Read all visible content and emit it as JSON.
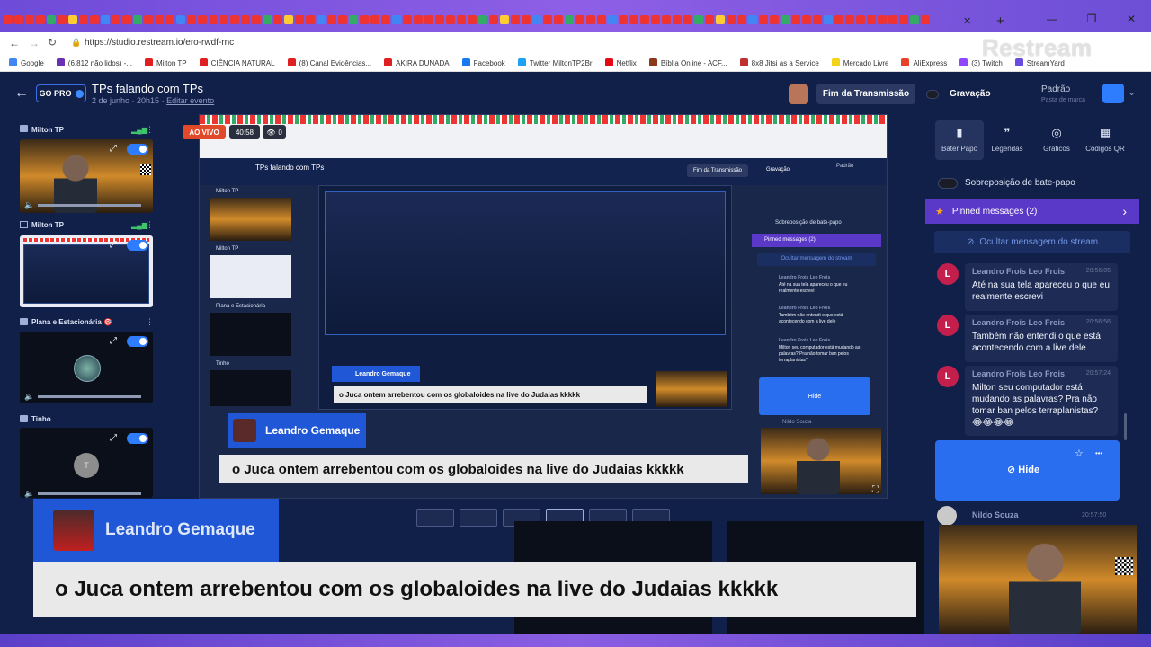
{
  "browser": {
    "url": "https://studio.restream.io/ero-rwdf-rnc",
    "window_controls": [
      "—",
      "❐",
      "✕"
    ],
    "new_tab": "+",
    "close_tab": "✕",
    "bookmarks": [
      {
        "label": "Google",
        "color": "#4285f4"
      },
      {
        "label": "(6.812 não lidos) -...",
        "color": "#6b2fb3"
      },
      {
        "label": "Milton TP",
        "color": "#e02020"
      },
      {
        "label": "CIÊNCIA NATURAL",
        "color": "#e02020"
      },
      {
        "label": "(8) Canal Evidências...",
        "color": "#e02020"
      },
      {
        "label": "AKIRA DUNADA",
        "color": "#e02020"
      },
      {
        "label": "Facebook",
        "color": "#1877f2"
      },
      {
        "label": "Twitter MiltonTP2Br",
        "color": "#1da1f2"
      },
      {
        "label": "Netflix",
        "color": "#e50914"
      },
      {
        "label": "Bíblia Online - ACF...",
        "color": "#8b3a1a"
      },
      {
        "label": "8x8 Jitsi as a Service",
        "color": "#c03030"
      },
      {
        "label": "Mercado Livre",
        "color": "#f5d21a"
      },
      {
        "label": "AliExpress",
        "color": "#e8432a"
      },
      {
        "label": "(3) Twitch",
        "color": "#9146ff"
      },
      {
        "label": "StreamYard",
        "color": "#6a4be0"
      }
    ],
    "watermark": "Restream"
  },
  "header": {
    "back_icon": "←",
    "go_pro": "GO PRO",
    "event_title": "TPs falando com TPs",
    "event_date": "2 de junho · 20h15 ·",
    "edit_event": "Editar evento",
    "end_stream": "Fim da Transmissão",
    "recording": "Gravação",
    "brand_title": "Padrão",
    "brand_sub": "Pasta de marca",
    "brand_chevron": "⌄"
  },
  "sources": [
    {
      "name": "Milton TP"
    },
    {
      "name": "Milton TP"
    },
    {
      "name": "Plana e Estacionária 🎯"
    },
    {
      "name": "Tinho",
      "avatar": "T"
    }
  ],
  "stage": {
    "live_badge": "AO VIVO",
    "timer": "40:58",
    "viewers": "0",
    "lower_third_name": "Leandro Gemaque",
    "lower_third_text": "o Juca ontem arrebentou com os globaloides na live do Judaias kkkkk",
    "nested_title": "TPs falando com TPs",
    "nested_end": "Fim da Transmissão",
    "nested_rec": "Gravação",
    "nested_padrao": "Padrão",
    "nested_chat_overlay": "Sobreposição de bate-papo",
    "nested_pinned": "Pinned messages (2)",
    "nested_hide_msg": "Ocultar mensagem do stream",
    "nested_hide": "Hide",
    "nested_nildo": "Nildo Souza",
    "nested_names": [
      "Milton TP",
      "Milton TP",
      "Plana e Estacionária",
      "Tinho"
    ],
    "nested_msgs": [
      {
        "name": "Leandro Frois Leo Frois",
        "text": "Até na sua tela apareceu o que eu realmente escrevi"
      },
      {
        "name": "Leandro Frois Leo Frois",
        "text": "Também não entendi o que está acontecendo com a live dele"
      },
      {
        "name": "Leandro Frois Leo Frois",
        "text": "Milton seu computador está mudando as palavras? Pra não tomar ban pelos terraplanistas?"
      }
    ]
  },
  "right_tabs": [
    {
      "label": "Bater Papo",
      "icon": "▮"
    },
    {
      "label": "Legendas",
      "icon": "❞"
    },
    {
      "label": "Gráficos",
      "icon": "◎"
    },
    {
      "label": "Códigos QR",
      "icon": "▦"
    }
  ],
  "chat": {
    "overlay_toggle_label": "Sobreposição de bate-papo",
    "pinned_label": "Pinned messages (2)",
    "pinned_star": "★",
    "pinned_chevron": "›",
    "hide_bar": "Ocultar mensagem do stream",
    "messages": [
      {
        "avatar": "L",
        "name": "Leandro Frois Leo Frois",
        "time": "20:56:05",
        "text": "Até na sua tela apareceu o que eu realmente escrevi"
      },
      {
        "avatar": "L",
        "name": "Leandro Frois Leo Frois",
        "time": "20:56:56",
        "text": "Também não entendi o que está acontecendo com a live dele"
      },
      {
        "avatar": "L",
        "name": "Leandro Frois Leo Frois",
        "time": "20:57:24",
        "text": "Milton seu computador está mudando as palavras? Pra não tomar ban pelos terraplanistas? 😂😂😂😂"
      }
    ],
    "hide_card_label": "Hide",
    "hide_card_star": "☆",
    "hide_card_more": "•••",
    "next_name": "Nildo Souza",
    "next_time": "20:57:50"
  },
  "bottom": {
    "name": "Leandro Gemaque",
    "text": "o Juca ontem arrebentou com os globaloides na live do Judaias kkkkk"
  },
  "colors": {
    "accent": "#2f7dff",
    "live": "#e0492a",
    "pinned": "#5b39c8",
    "avatar": "#c41f4c"
  }
}
